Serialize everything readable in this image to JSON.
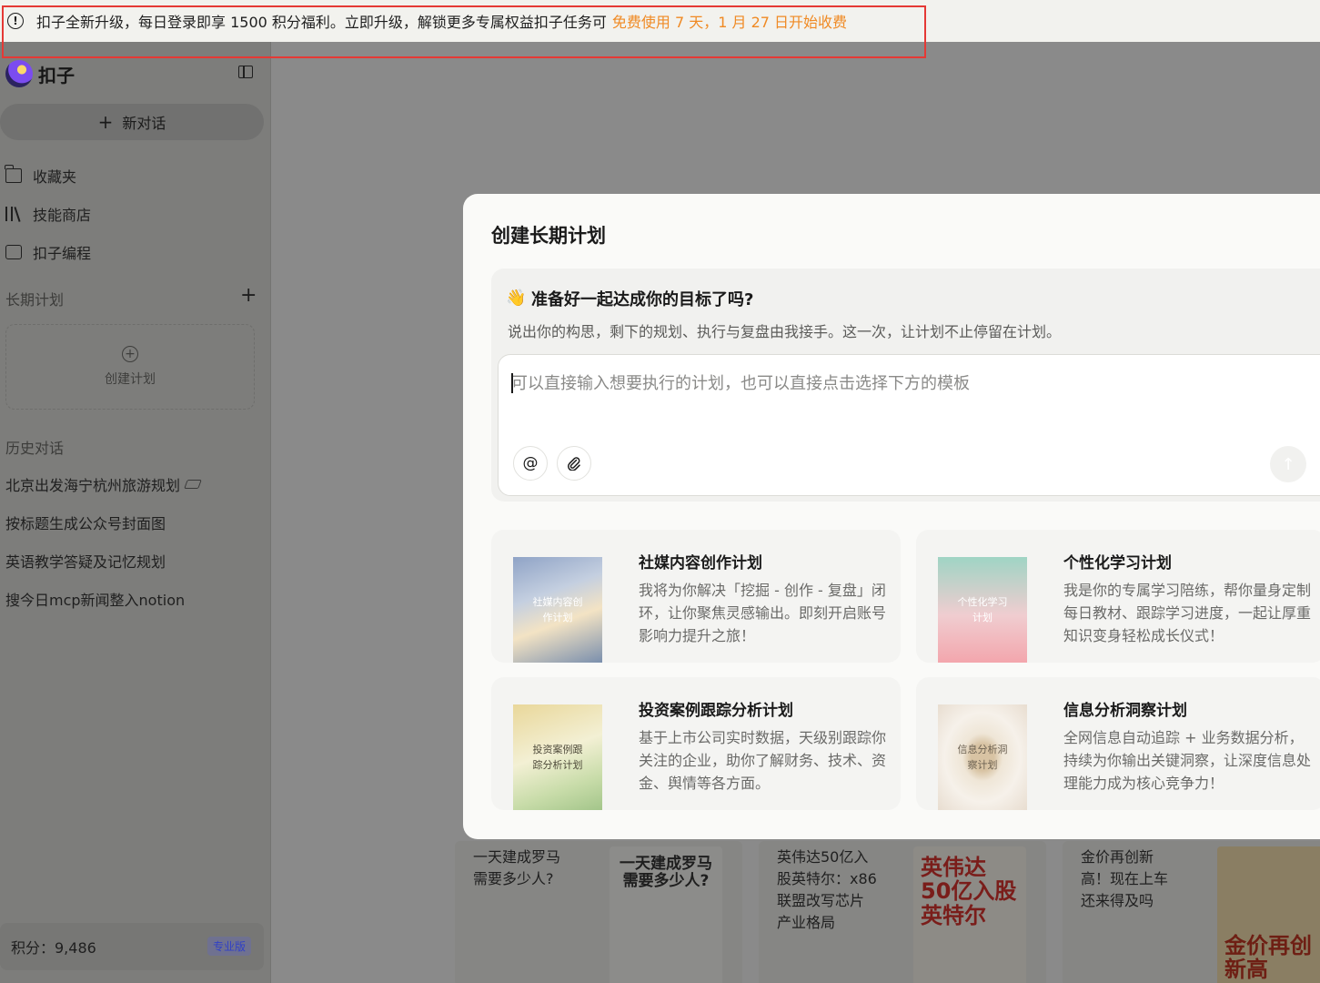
{
  "banner": {
    "text": "扣子全新升级，每日登录即享 1500 积分福利。立即升级，解锁更多专属权益扣子任务可",
    "highlight": "免费使用 7 天，1 月 27 日开始收费",
    "accent_color": "#f08a24",
    "icon": "info-circle-icon"
  },
  "sidebar": {
    "brand": "扣子",
    "new_chat": "新对话",
    "nav": [
      {
        "label": "收藏夹",
        "icon": "folder-icon"
      },
      {
        "label": "技能商店",
        "icon": "books-icon"
      },
      {
        "label": "扣子编程",
        "icon": "code-icon"
      }
    ],
    "plans_label": "长期计划",
    "create_plan": "创建计划",
    "history_label": "历史对话",
    "history": [
      {
        "label": "北京出发海宁杭州旅游规划"
      },
      {
        "label": "按标题生成公众号封面图"
      },
      {
        "label": "英语教学答疑及记忆规划"
      },
      {
        "label": "搜今日mcp新闻整入notion"
      }
    ],
    "points": "积分：9,486",
    "badge": "专业版"
  },
  "feed": [
    {
      "text": "一天建成罗马\n需要多少人?",
      "image_text": "一天建成罗马\n需要多少人?"
    },
    {
      "text": "英伟达50亿入\n股英特尔：x86\n联盟改写芯片\n产业格局",
      "image_text": "英伟达\n50亿入股\n英特尔"
    },
    {
      "text": "金价再创新\n高！现在上车\n还来得及吗",
      "image_text": "金价再创\n新高"
    }
  ],
  "modal": {
    "title": "创建长期计划",
    "heading": "准备好一起达成你的目标了吗?",
    "subtitle": "说出你的构思，剩下的规划、执行与复盘由我接手。这一次，让计划不止停留在计划。",
    "placeholder": "可以直接输入想要执行的计划，也可以直接点击选择下方的模板",
    "templates": [
      {
        "title": "社媒内容创作计划",
        "desc": "我将为你解决「挖掘 - 创作 - 复盘」闭环，让你聚焦灵感输出。即刻开启账号影响力提升之旅！",
        "thumb": "社媒内容创作计划"
      },
      {
        "title": "个性化学习计划",
        "desc": "我是你的专属学习陪练，帮你量身定制每日教材、跟踪学习进度，一起让厚重知识变身轻松成长仪式！",
        "thumb": "个性化学习计划"
      },
      {
        "title": "投资案例跟踪分析计划",
        "desc": "基于上市公司实时数据，天级别跟踪你关注的企业，助你了解财务、技术、资金、舆情等各方面。",
        "thumb": "投资案例跟踪分析计划"
      },
      {
        "title": "信息分析洞察计划",
        "desc": "全网信息自动追踪 + 业务数据分析，持续为你输出关键洞察，让深度信息处理能力成为核心竞争力！",
        "thumb": "信息分析洞察计划"
      }
    ]
  }
}
